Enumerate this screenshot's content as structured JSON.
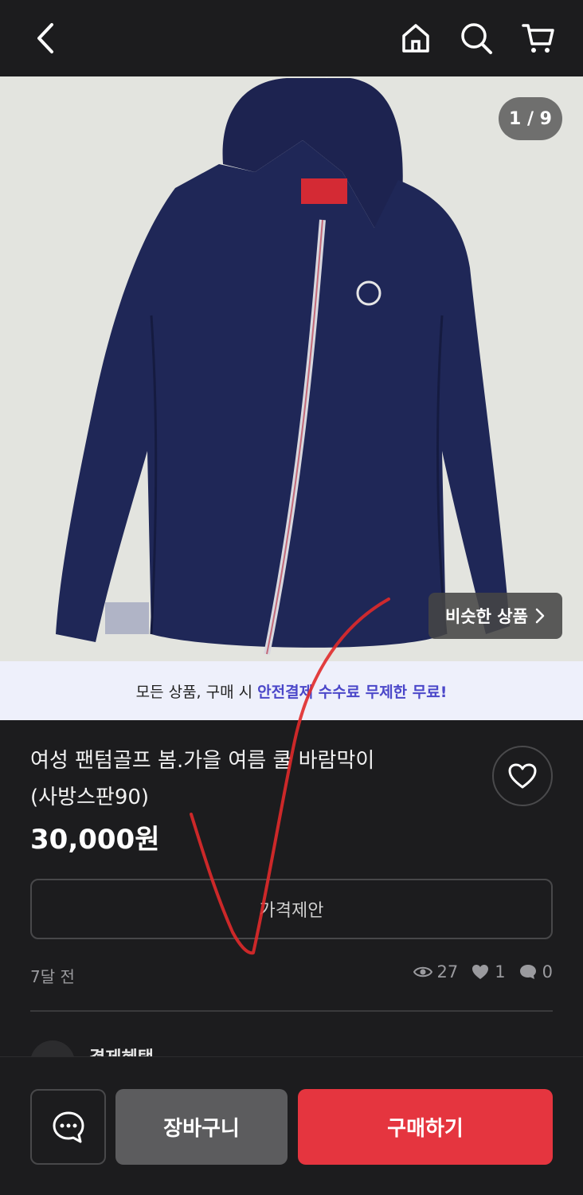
{
  "header": {
    "back_icon": "chevron-left-icon",
    "home_icon": "home-icon",
    "search_icon": "search-icon",
    "cart_icon": "cart-icon"
  },
  "gallery": {
    "counter": "1 / 9",
    "similar_label": "비슷한 상품",
    "image_description": "navy hooded windbreaker jacket"
  },
  "promo": {
    "text": "모든 상품, 구매 시",
    "highlight": "안전결제 수수료 무제한 무료!"
  },
  "product": {
    "title_line1": "여성 팬텀골프 봄.가을 여름 쿨 바람막이",
    "title_line2": "(사방스판90)",
    "price": "30,000원"
  },
  "actions": {
    "offer_label": "가격제안"
  },
  "meta": {
    "time_ago": "7달 전",
    "views": "27",
    "likes": "1",
    "chats": "0"
  },
  "section_peek": {
    "label": "결제혜택"
  },
  "bottom": {
    "cart_label": "장바구니",
    "buy_label": "구매하기"
  },
  "colors": {
    "accent": "#e5353f",
    "promo_highlight": "#4b47c9",
    "background": "#1c1c1e"
  }
}
